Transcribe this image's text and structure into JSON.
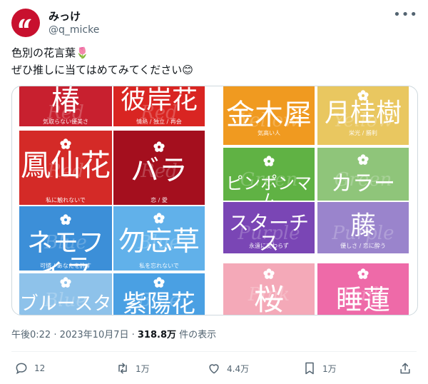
{
  "post": {
    "author_name": "みっけ",
    "author_handle": "@q_micke",
    "text_line1": "色別の花言葉🌷",
    "text_line2": "ぜひ推しに当てはめてみてください😊",
    "timestamp": "午後0:22 · 2023年10月7日 · ",
    "views_count": "318.8万",
    "views_suffix": " 件の表示"
  },
  "actions": {
    "reply_count": "12",
    "repost_count": "1万",
    "like_count": "4.4万",
    "bookmark_count": "1万"
  },
  "image": {
    "tiles": [
      {
        "name": "椿",
        "meaning": "気取らない優美さ",
        "color": "#c8202f",
        "ghost": "Red"
      },
      {
        "name": "彼岸花",
        "meaning": "情熱 / 独立 / 再会",
        "color": "#d92522",
        "ghost": "Red"
      },
      {
        "name": "鳳仙花",
        "meaning": "私に触れないで",
        "color": "#d42a27",
        "ghost": "Red"
      },
      {
        "name": "バラ",
        "meaning": "恋 / 愛",
        "color": "#a40f1e",
        "ghost": "Red"
      },
      {
        "name": "ネモフィラ",
        "meaning": "可憐 / あなたを許す",
        "color": "#3c8fd8",
        "ghost": "Blue"
      },
      {
        "name": "勿忘草",
        "meaning": "私を忘れないで",
        "color": "#61b1ea",
        "ghost": "Blue"
      },
      {
        "name": "ブルースター",
        "meaning": "",
        "color": "#8ec2ea",
        "ghost": "Blue"
      },
      {
        "name": "紫陽花",
        "meaning": "",
        "color": "#4aa0e3",
        "ghost": "Blue"
      },
      {
        "name": "金木犀",
        "meaning": "気高い人",
        "color": "#f09a20",
        "ghost": "Yellow"
      },
      {
        "name": "月桂樹",
        "meaning": "栄光 / 勝利",
        "color": "#e9c760",
        "ghost": "Yellow"
      },
      {
        "name": "ピンポンマム",
        "meaning": "",
        "color": "#60b244",
        "ghost": "Green"
      },
      {
        "name": "カラー",
        "meaning": "",
        "color": "#8fc57a",
        "ghost": "Green"
      },
      {
        "name": "スターチス",
        "meaning": "永遠に変わらず",
        "color": "#7a46b5",
        "ghost": "Purple"
      },
      {
        "name": "藤",
        "meaning": "優しさ / 恋に酔う",
        "color": "#9a84cc",
        "ghost": "Purple"
      },
      {
        "name": "桜",
        "meaning": "",
        "color": "#f4a9b8",
        "ghost": "Pink"
      },
      {
        "name": "睡蓮",
        "meaning": "",
        "color": "#ee6aa8",
        "ghost": "Pink"
      }
    ]
  }
}
